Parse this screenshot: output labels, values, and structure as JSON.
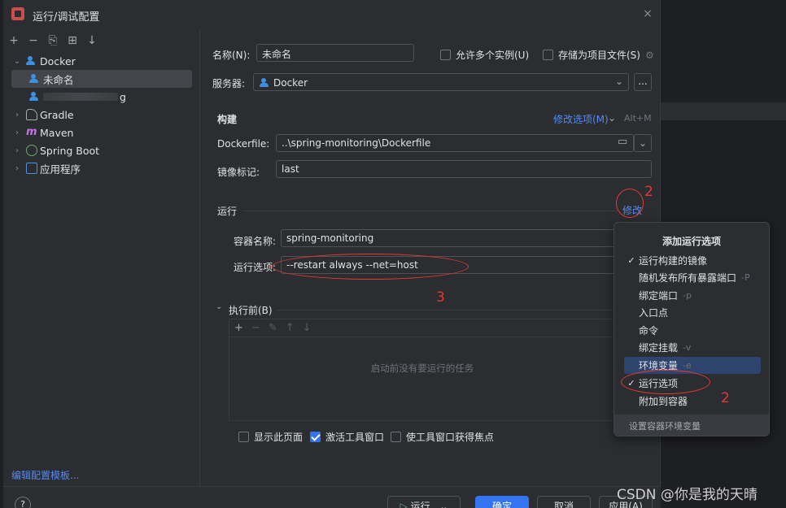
{
  "dialog": {
    "title": "运行/调试配置",
    "close": "×"
  },
  "tree": {
    "toolbar": [
      "+",
      "−",
      "⎘",
      "⊞",
      "↓"
    ],
    "items": [
      {
        "label": "Docker",
        "level": 0,
        "expanded": true
      },
      {
        "label": "未命名",
        "level": 1,
        "selected": true
      },
      {
        "label": "g",
        "level": 1
      },
      {
        "label": "Gradle",
        "level": 0
      },
      {
        "label": "Maven",
        "level": 0
      },
      {
        "label": "Spring Boot",
        "level": 0
      },
      {
        "label": "应用程序",
        "level": 0
      }
    ],
    "edit_templates": "编辑配置模板..."
  },
  "form": {
    "name_label": "名称(N):",
    "name_value": "未命名",
    "allow_multiple": "允许多个实例(U)",
    "store_as_file": "存储为项目文件(S)",
    "server_label": "服务器:",
    "server_value": "Docker",
    "server_more": "...",
    "build_section": "构建",
    "modify_options": "修改选项(M)",
    "modify_shortcut": "Alt+M",
    "dockerfile_label": "Dockerfile:",
    "dockerfile_value": "..\\spring-monitoring\\Dockerfile",
    "image_tag_label": "镜像标记:",
    "image_tag_value": "last",
    "run_section": "运行",
    "modify": "修改",
    "container_name_label": "容器名称:",
    "container_name_value": "spring-monitoring",
    "run_options_label": "运行选项:",
    "run_options_value": "--restart always --net=host",
    "before_launch": "执行前(B)",
    "task_toolbar": [
      "+",
      "−",
      "✎",
      "↑",
      "↓"
    ],
    "no_tasks": "启动前没有要运行的任务",
    "show_page": "显示此页面",
    "activate_tool": "激活工具窗口",
    "focus_tool": "使工具窗口获得焦点"
  },
  "bottom": {
    "help": "?",
    "run": "运行",
    "ok": "确定",
    "cancel": "取消",
    "apply": "应用(A)"
  },
  "popup": {
    "title": "添加运行选项",
    "items": [
      {
        "label": "运行构建的镜像",
        "checked": true,
        "shortcut": ""
      },
      {
        "label": "随机发布所有暴露端口",
        "checked": false,
        "shortcut": "-P"
      },
      {
        "label": "绑定端口",
        "checked": false,
        "shortcut": "-p"
      },
      {
        "label": "入口点",
        "checked": false,
        "shortcut": ""
      },
      {
        "label": "命令",
        "checked": false,
        "shortcut": ""
      },
      {
        "label": "绑定挂载",
        "checked": false,
        "shortcut": "-v"
      },
      {
        "label": "环境变量",
        "checked": false,
        "shortcut": "-e",
        "highlighted": true
      },
      {
        "label": "运行选项",
        "checked": true,
        "shortcut": ""
      },
      {
        "label": "附加到容器",
        "checked": false,
        "shortcut": ""
      }
    ],
    "footer": "设置容器环境变量"
  },
  "annotations": {
    "n1": "2",
    "n2": "3",
    "n3": "2"
  },
  "watermark": "CSDN @你是我的天晴",
  "colors": {
    "accent": "#3574f0",
    "link": "#548af7",
    "annotation": "#e53935"
  }
}
